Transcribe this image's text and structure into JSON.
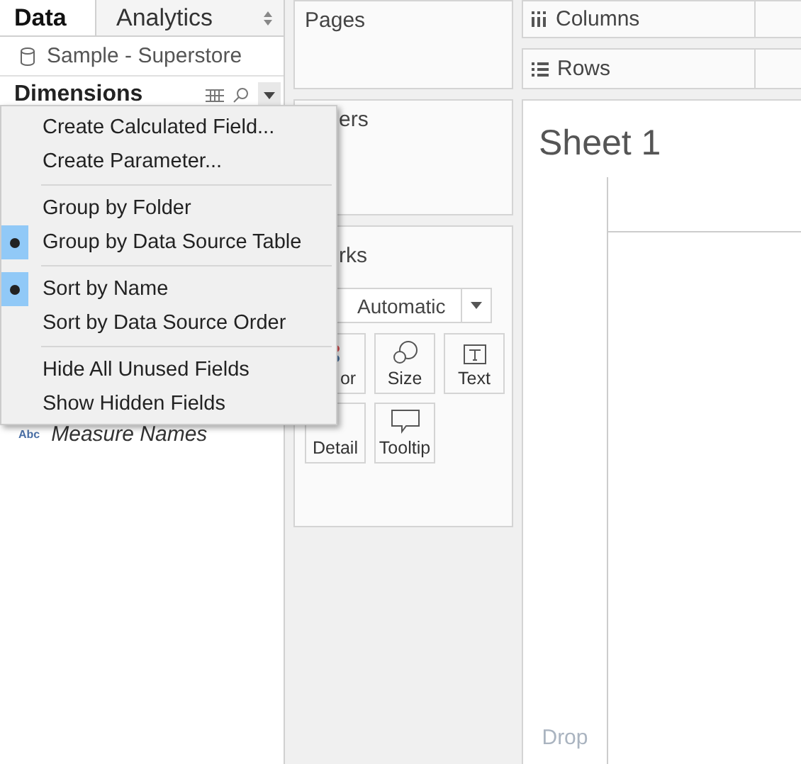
{
  "left_pane": {
    "tabs": [
      {
        "label": "Data",
        "selected": true
      },
      {
        "label": "Analytics",
        "selected": false
      }
    ],
    "data_source": "Sample - Superstore",
    "dimensions_title": "Dimensions",
    "fields": [
      {
        "badge": "Abc",
        "label": "Measure Names"
      }
    ]
  },
  "context_menu": {
    "items": [
      {
        "kind": "item",
        "label": "Create Calculated Field..."
      },
      {
        "kind": "item",
        "label": "Create Parameter..."
      },
      {
        "kind": "separator"
      },
      {
        "kind": "radio",
        "label": "Group by Folder",
        "selected": false
      },
      {
        "kind": "radio",
        "label": "Group by Data Source Table",
        "selected": true
      },
      {
        "kind": "separator"
      },
      {
        "kind": "radio",
        "label": "Sort by Name",
        "selected": true
      },
      {
        "kind": "radio",
        "label": "Sort by Data Source Order",
        "selected": false
      },
      {
        "kind": "separator"
      },
      {
        "kind": "item",
        "label": "Hide All Unused Fields"
      },
      {
        "kind": "item",
        "label": "Show Hidden Fields"
      }
    ]
  },
  "pages": {
    "title": "Pages"
  },
  "filters": {
    "title": "ers"
  },
  "marks": {
    "title": "rks",
    "mark_type": "Automatic",
    "buttons": [
      {
        "kind": "color",
        "label": "or"
      },
      {
        "kind": "size",
        "label": "Size"
      },
      {
        "kind": "text",
        "label": "Text"
      },
      {
        "kind": "none",
        "label": "Detail"
      },
      {
        "kind": "tooltip",
        "label": "Tooltip"
      }
    ]
  },
  "columns_shelf": {
    "label": "Columns"
  },
  "rows_shelf": {
    "label": "Rows"
  },
  "sheet": {
    "title": "Sheet 1",
    "drop_hint": "Drop"
  }
}
